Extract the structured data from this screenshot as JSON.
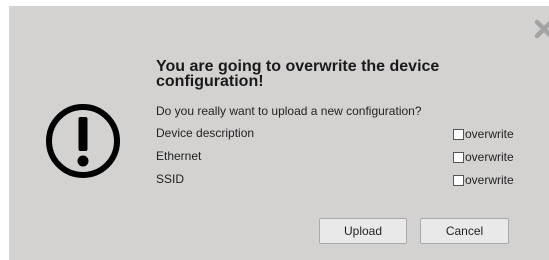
{
  "dialog": {
    "title": "You are going to overwrite the device configuration!",
    "question": "Do you really want to upload a new configuration?",
    "close_icon": "close-icon",
    "warning_icon": "exclamation-circle-icon",
    "rows": [
      {
        "label": "Device description",
        "checkbox_label": "overwrite",
        "checked": false
      },
      {
        "label": "Ethernet",
        "checkbox_label": "overwrite",
        "checked": false
      },
      {
        "label": "SSID",
        "checkbox_label": "overwrite",
        "checked": false
      }
    ],
    "upload_label": "Upload",
    "cancel_label": "Cancel"
  },
  "colors": {
    "dialog_background": "#d4d2d1",
    "button_background": "#e9e9e9",
    "icon_color": "#000000",
    "close_icon_color": "#a3a3a3"
  }
}
